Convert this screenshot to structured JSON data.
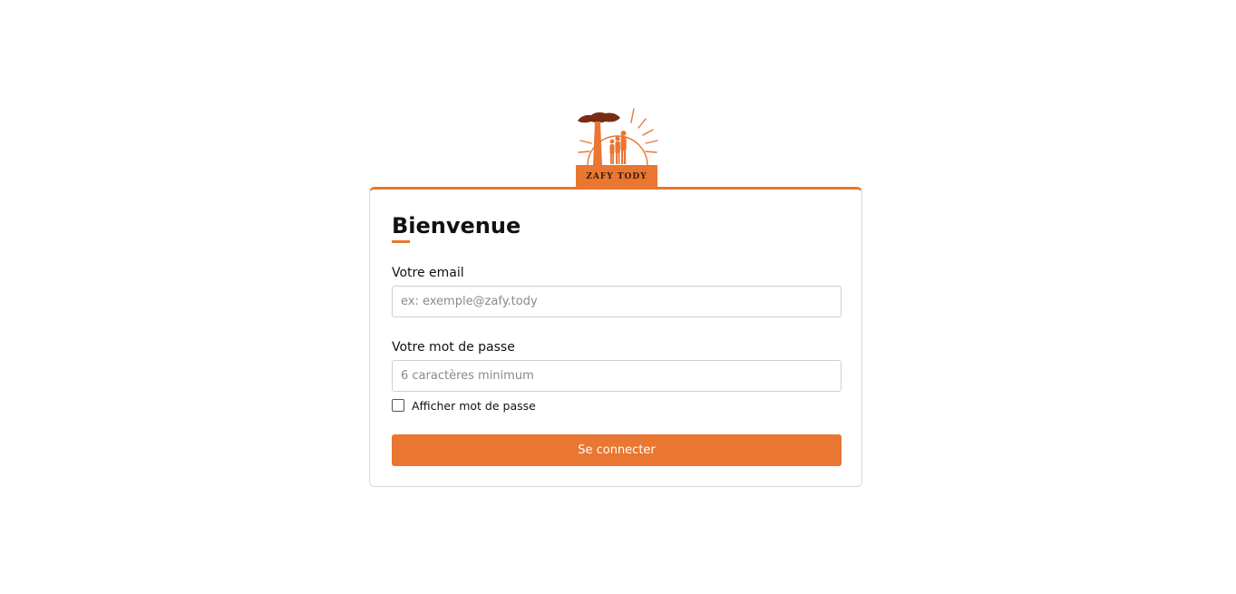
{
  "brand": {
    "name": "ZAFY TODY",
    "logo_icon": "baobab-family-sun-icon",
    "accent_color": "#e97631"
  },
  "login": {
    "title": "Bienvenue",
    "email_label": "Votre email",
    "email_placeholder": "ex: exemple@zafy.tody",
    "email_value": "",
    "password_label": "Votre mot de passe",
    "password_placeholder": "6 caractères minimum",
    "password_value": "",
    "show_password_label": "Afficher mot de passe",
    "show_password_checked": false,
    "submit_label": "Se connecter"
  }
}
